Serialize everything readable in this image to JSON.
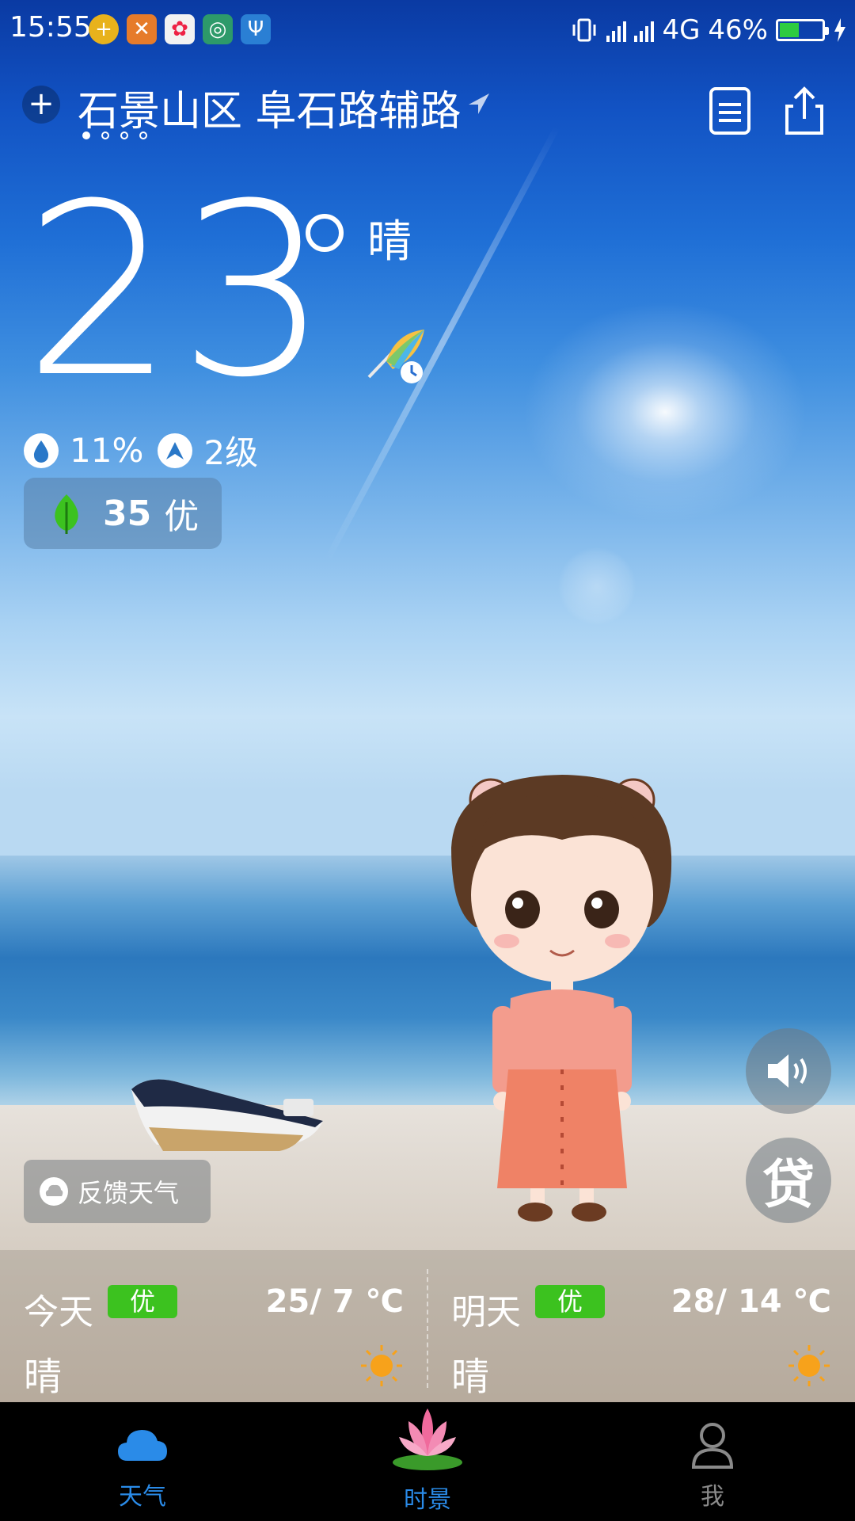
{
  "status_bar": {
    "time": "15:55",
    "network": "4G",
    "battery_percent": "46%",
    "battery_level": 0.46,
    "app_icons": [
      "plus-app-icon",
      "crossed-app-icon",
      "pinwheel-app-icon",
      "hotspot-icon",
      "usb-icon"
    ]
  },
  "header": {
    "location": "石景山区 阜石路辅路",
    "page_count": 4,
    "active_page": 0
  },
  "current": {
    "temperature": "23",
    "condition": "晴",
    "humidity": "11%",
    "wind": "2级",
    "aqi_value": "35",
    "aqi_label": "优"
  },
  "buttons": {
    "loan": "贷",
    "feedback": "反馈天气"
  },
  "forecast": [
    {
      "day": "今天",
      "quality": "优",
      "temp": "25/ 7 ℃",
      "condition": "晴",
      "icon": "sun-icon"
    },
    {
      "day": "明天",
      "quality": "优",
      "temp": "28/ 14 ℃",
      "condition": "晴",
      "icon": "sun-icon"
    }
  ],
  "nav": [
    {
      "label": "天气",
      "icon": "cloud-icon",
      "active": true
    },
    {
      "label": "时景",
      "icon": "lotus-icon",
      "active": false
    },
    {
      "label": "我",
      "icon": "user-icon",
      "active": false
    }
  ],
  "colors": {
    "sky_top": "#0a3aa3",
    "aqi_green": "#3cc21f",
    "nav_active": "#2a8be8",
    "nav_inactive": "#8a8a8a"
  }
}
